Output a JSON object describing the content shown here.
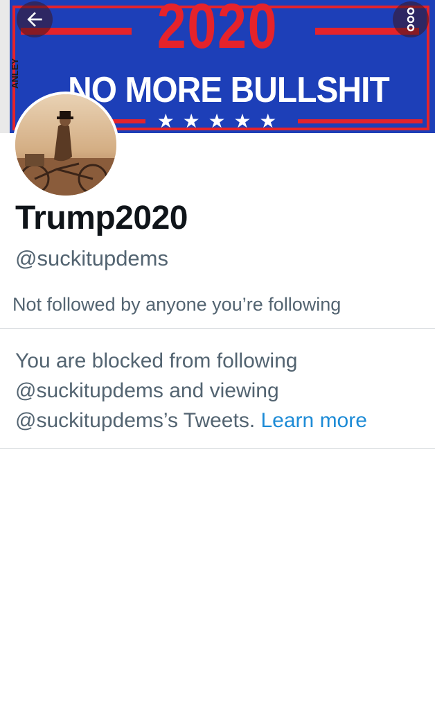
{
  "banner": {
    "year": "2020",
    "slogan": "NO MORE BULLSHIT",
    "brand": "ANLEY",
    "stars": "★ ★ ★ ★ ★"
  },
  "nav": {
    "back_icon": "arrow-left-icon",
    "more_icon": "more-vertical-icon"
  },
  "profile": {
    "display_name": "Trump2020",
    "handle": "@suckitupdems",
    "followers_note": "Not followed by anyone you’re following"
  },
  "blocked": {
    "message": "You are blocked from following @suckitupdems and viewing @suckitupdems’s Tweets. ",
    "link": "Learn more"
  },
  "colors": {
    "banner_blue": "#1d3fb8",
    "banner_red": "#e5232b",
    "link_blue": "#1d8bd6",
    "secondary_text": "#536471"
  }
}
